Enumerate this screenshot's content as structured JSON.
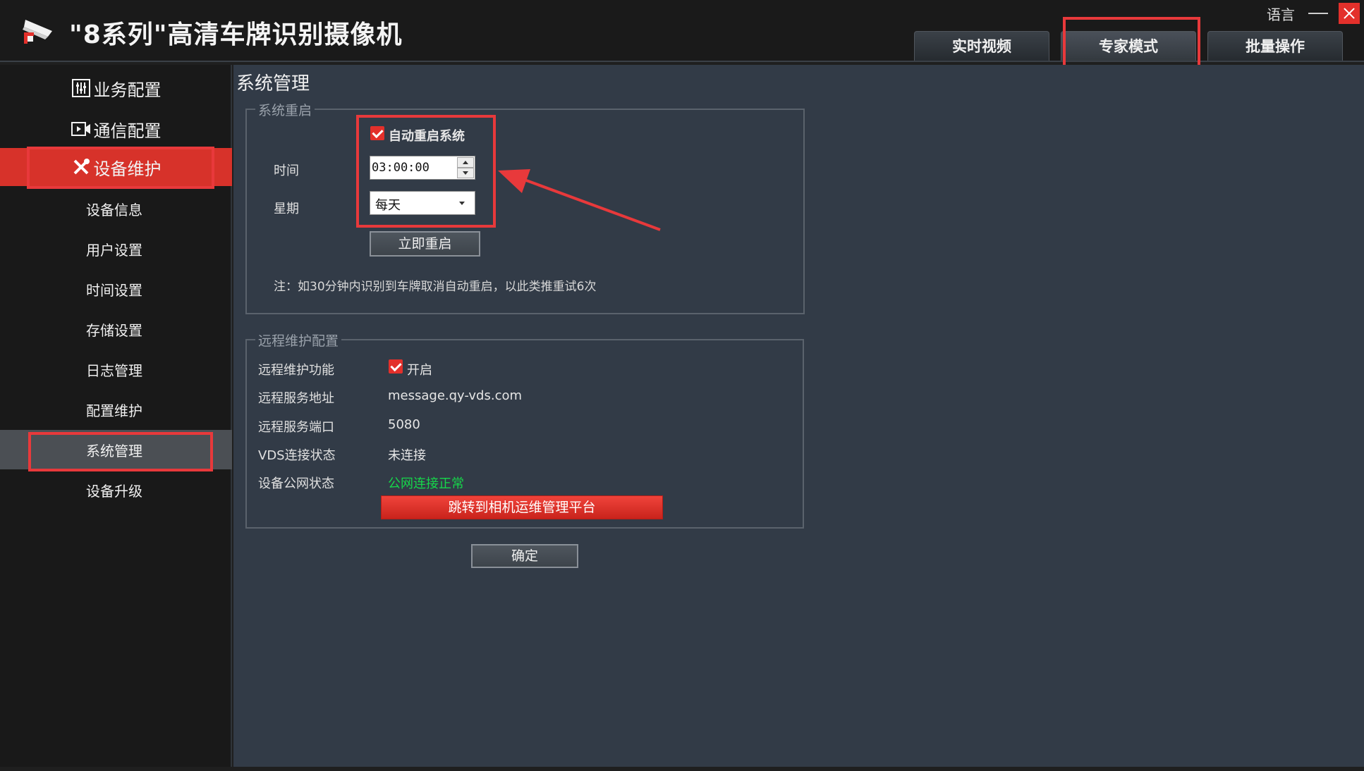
{
  "app": {
    "title": "\"8系列\"高清车牌识别摄像机",
    "language_label": "语言"
  },
  "top_tabs": [
    {
      "label": "实时视频"
    },
    {
      "label": "专家模式"
    },
    {
      "label": "批量操作"
    }
  ],
  "sidebar": {
    "groups": [
      {
        "label": "业务配置",
        "icon": "sliders-icon"
      },
      {
        "label": "通信配置",
        "icon": "video-camera-icon"
      },
      {
        "label": "设备维护",
        "icon": "tools-icon"
      }
    ],
    "items": [
      {
        "label": "设备信息"
      },
      {
        "label": "用户设置"
      },
      {
        "label": "时间设置"
      },
      {
        "label": "存储设置"
      },
      {
        "label": "日志管理"
      },
      {
        "label": "配置维护"
      },
      {
        "label": "系统管理"
      },
      {
        "label": "设备升级"
      }
    ]
  },
  "main": {
    "page_title": "系统管理",
    "restart": {
      "legend": "系统重启",
      "auto_restart_label": "自动重启系统",
      "auto_restart_checked": true,
      "time_label": "时间",
      "time_value": "03:00:00",
      "week_label": "星期",
      "week_value": "每天",
      "restart_now_label": "立即重启",
      "note": "注：如30分钟内识别到车牌取消自动重启，以此类推重试6次"
    },
    "remote": {
      "legend": "远程维护配置",
      "function_label": "远程维护功能",
      "function_checked": true,
      "function_value": "开启",
      "address_label": "远程服务地址",
      "address_value": "message.qy-vds.com",
      "port_label": "远程服务端口",
      "port_value": "5080",
      "vds_label": "VDS连接状态",
      "vds_value": "未连接",
      "public_label": "设备公网状态",
      "public_value": "公网连接正常",
      "jump_button_label": "跳转到相机运维管理平台"
    },
    "confirm_label": "确定"
  },
  "colors": {
    "accent_red": "#e3302b",
    "status_green": "#16d64a",
    "panel_bg": "#323b47"
  }
}
